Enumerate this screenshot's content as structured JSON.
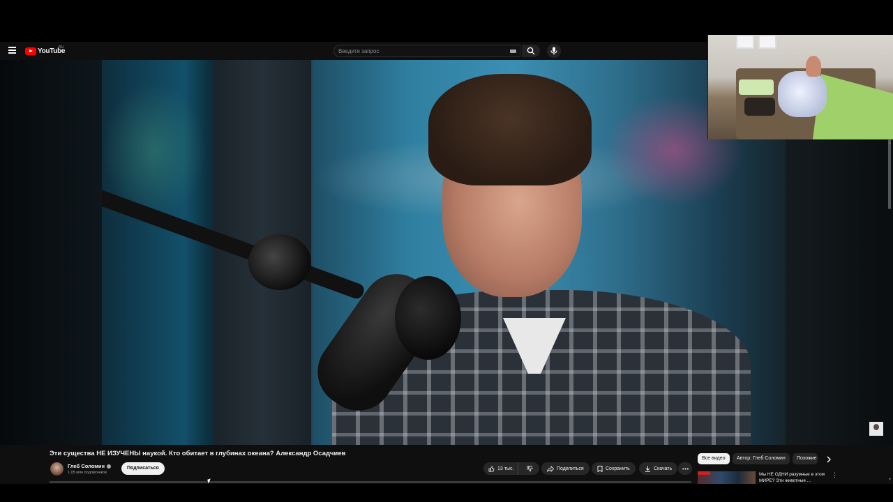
{
  "header": {
    "logo_text": "YouTube",
    "region": "RU",
    "search_placeholder": "Введите запрос"
  },
  "video": {
    "title": "Эти существа НЕ ИЗУЧЕНЫ наукой. Кто обитает в глубинах океана? Александр Осадчиев",
    "channel": "Глеб Соломин",
    "subscribers": "1,05 млн подписчиков",
    "subscribe_label": "Подписаться",
    "likes": "13 тыс.",
    "share_label": "Поделиться",
    "save_label": "Сохранить",
    "download_label": "Скачать"
  },
  "sidebar": {
    "chips": [
      "Все видео",
      "Автор: Глеб Соломин",
      "Похожие"
    ],
    "recommendation": {
      "title": "Мы НЕ ОДНИ разумные в этом МИРЕ? Эти животные ..."
    }
  },
  "colors": {
    "background": "#0f0f0f",
    "brand": "#ff0000",
    "chip_active": "#f1f1f1"
  }
}
